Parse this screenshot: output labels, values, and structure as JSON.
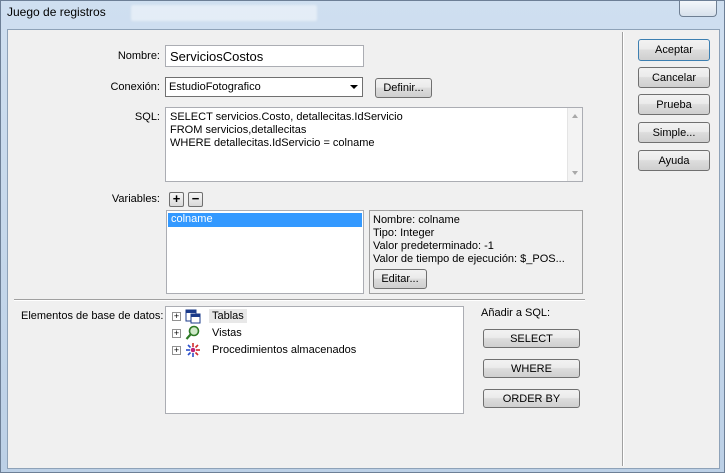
{
  "window": {
    "title": "Juego de registros"
  },
  "form": {
    "nombre_label": "Nombre:",
    "nombre_value": "ServiciosCostos",
    "conexion_label": "Conexión:",
    "conexion_value": "EstudioFotografico",
    "definir_label": "Definir...",
    "sql_label": "SQL:",
    "sql_value": "SELECT servicios.Costo, detallecitas.IdServicio\nFROM servicios,detallecitas\nWHERE detallecitas.IdServicio = colname",
    "variables_label": "Variables:",
    "add_variable": "+",
    "remove_variable": "−"
  },
  "variables": {
    "items": [
      "colname"
    ],
    "selected": "colname",
    "info": {
      "nombre": "Nombre: colname",
      "tipo": "Tipo: Integer",
      "valor_predeterminado": "Valor predeterminado: -1",
      "valor_ejecucion": "Valor de tiempo de ejecución: $_POS..."
    },
    "editar_label": "Editar..."
  },
  "database": {
    "label": "Elementos de base de datos:",
    "items": [
      {
        "label": "Tablas",
        "icon": "table-icon",
        "selected": true
      },
      {
        "label": "Vistas",
        "icon": "view-icon",
        "selected": false
      },
      {
        "label": "Procedimientos almacenados",
        "icon": "stored-procedure-icon",
        "selected": false
      }
    ],
    "expander_symbol": "+"
  },
  "sql_actions": {
    "label": "Añadir a SQL:",
    "select_label": "SELECT",
    "where_label": "WHERE",
    "orderby_label": "ORDER BY"
  },
  "side_buttons": {
    "aceptar": "Aceptar",
    "cancelar": "Cancelar",
    "prueba": "Prueba",
    "simple": "Simple...",
    "ayuda": "Ayuda"
  },
  "colors": {
    "selection": "#3399ff",
    "dialog_bg": "#f0f0f0",
    "frame": "#c9d8ea"
  }
}
